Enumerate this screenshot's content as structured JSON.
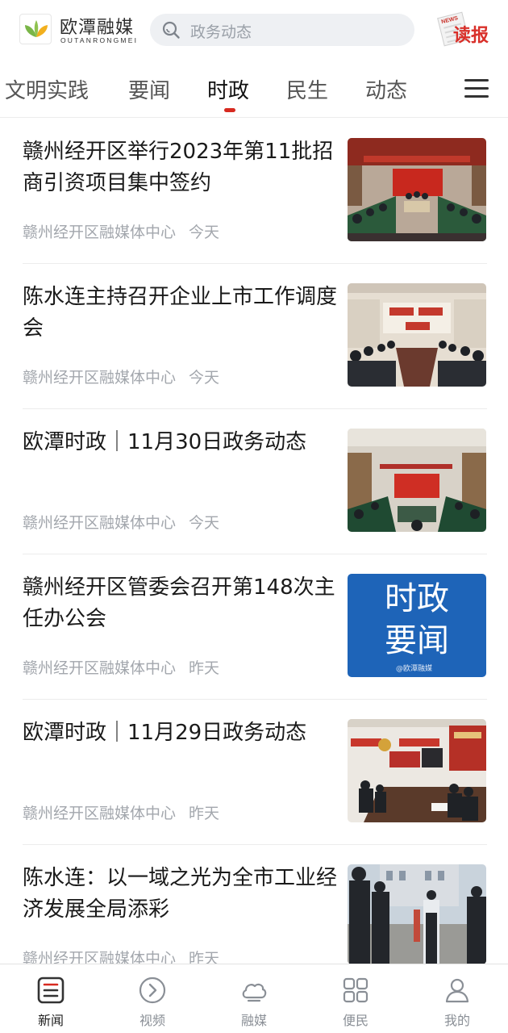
{
  "header": {
    "logo_cn": "欧潭融媒",
    "logo_en": "OUTANRONGMEI",
    "search_placeholder": "政务动态",
    "dubao_label": "读报",
    "dubao_paper_text": "NEWS"
  },
  "tabs": [
    {
      "label": "文明实践",
      "active": false
    },
    {
      "label": "要闻",
      "active": false
    },
    {
      "label": "时政",
      "active": true
    },
    {
      "label": "民生",
      "active": false
    },
    {
      "label": "动态",
      "active": false
    }
  ],
  "news": [
    {
      "title": "赣州经开区举行2023年第11批招商引资项目集中签约",
      "source": "赣州经开区融媒体中心",
      "time": "今天",
      "thumb": "meeting-hall-red-banner"
    },
    {
      "title": "陈水连主持召开企业上市工作调度会",
      "source": "赣州经开区融媒体中心",
      "time": "今天",
      "thumb": "meeting-room-slogan"
    },
    {
      "title": "欧潭时政｜11月30日政务动态",
      "source": "赣州经开区融媒体中心",
      "time": "今天",
      "thumb": "conference-red-screen"
    },
    {
      "title": "赣州经开区管委会召开第148次主任办公会",
      "source": "赣州经开区融媒体中心",
      "time": "昨天",
      "thumb": "blue-card",
      "thumb_line1": "时政",
      "thumb_line2": "要闻",
      "thumb_watermark": "@欧潭融媒"
    },
    {
      "title": "欧潭时政｜11月29日政务动态",
      "source": "赣州经开区融媒体中心",
      "time": "昨天",
      "thumb": "community-meeting"
    },
    {
      "title": "陈水连：以一域之光为全市工业经济发展全局添彩",
      "source": "赣州经开区融媒体中心",
      "time": "昨天",
      "thumb": "outdoor-inspection"
    }
  ],
  "bottom_nav": [
    {
      "label": "新闻",
      "icon": "news-icon",
      "active": true
    },
    {
      "label": "视频",
      "icon": "play-circle-icon",
      "active": false
    },
    {
      "label": "融媒",
      "icon": "cloud-icon",
      "active": false
    },
    {
      "label": "便民",
      "icon": "grid-icon",
      "active": false
    },
    {
      "label": "我的",
      "icon": "user-icon",
      "active": false
    }
  ],
  "colors": {
    "accent": "#d72a20",
    "meta_text": "#a3a7ad",
    "thumb_blue": "#1e64b8"
  }
}
